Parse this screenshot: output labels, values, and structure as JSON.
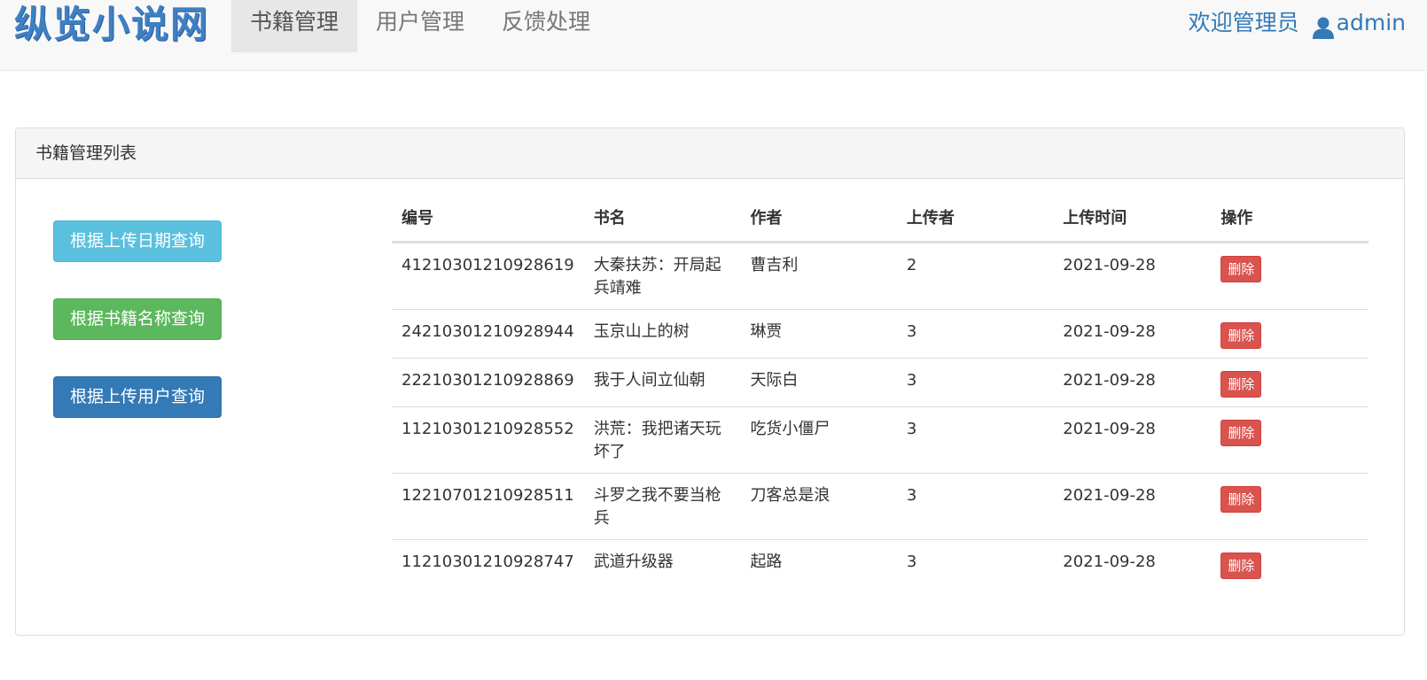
{
  "navbar": {
    "brand": "纵览小说网",
    "items": [
      {
        "label": "书籍管理",
        "active": true
      },
      {
        "label": "用户管理",
        "active": false
      },
      {
        "label": "反馈处理",
        "active": false
      }
    ],
    "welcome_text": "欢迎管理员",
    "username": "admin"
  },
  "panel": {
    "title": "书籍管理列表",
    "buttons": {
      "by_date": "根据上传日期查询",
      "by_name": "根据书籍名称查询",
      "by_user": "根据上传用户查询"
    },
    "table": {
      "headers": [
        "编号",
        "书名",
        "作者",
        "上传者",
        "上传时间",
        "操作"
      ],
      "delete_label": "删除",
      "rows": [
        {
          "id": "41210301210928619",
          "name": "大秦扶苏：开局起兵靖难",
          "author": "曹吉利",
          "uploader": "2",
          "time": "2021-09-28"
        },
        {
          "id": "24210301210928944",
          "name": "玉京山上的树",
          "author": "琳贾",
          "uploader": "3",
          "time": "2021-09-28"
        },
        {
          "id": "22210301210928869",
          "name": "我于人间立仙朝",
          "author": "天际白",
          "uploader": "3",
          "time": "2021-09-28"
        },
        {
          "id": "11210301210928552",
          "name": "洪荒：我把诸天玩坏了",
          "author": "吃货小僵尸",
          "uploader": "3",
          "time": "2021-09-28"
        },
        {
          "id": "12210701210928511",
          "name": "斗罗之我不要当枪兵",
          "author": "刀客总是浪",
          "uploader": "3",
          "time": "2021-09-28"
        },
        {
          "id": "11210301210928747",
          "name": "武道升级器",
          "author": "起路",
          "uploader": "3",
          "time": "2021-09-28"
        }
      ]
    }
  },
  "colors": {
    "brand": "#3f7fc4",
    "link": "#337ab7",
    "info": "#5bc0de",
    "success": "#5cb85c",
    "primary": "#337ab7",
    "danger": "#d9534f"
  }
}
